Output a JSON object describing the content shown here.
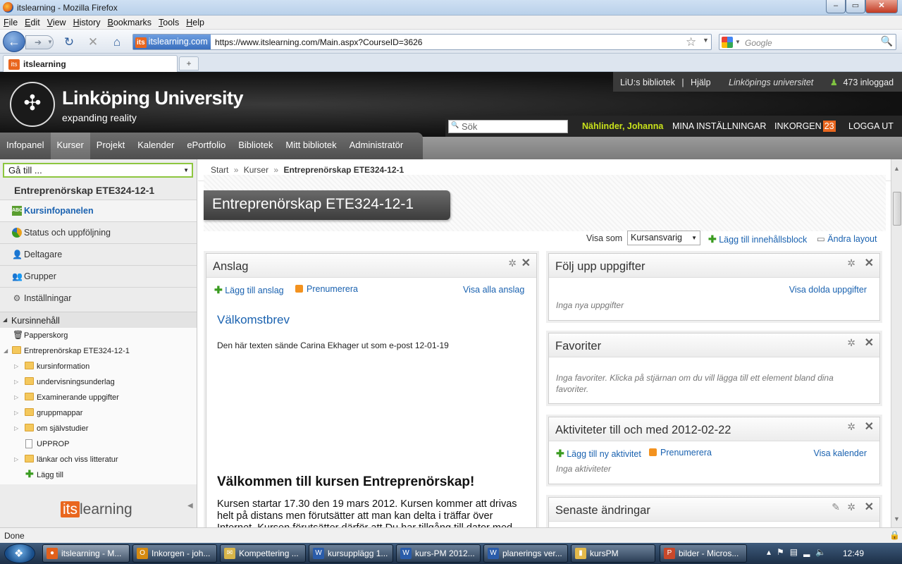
{
  "window": {
    "title": "itslearning - Mozilla Firefox",
    "controls": [
      "–",
      "▭",
      "✕"
    ]
  },
  "menu": [
    {
      "u": "F",
      "rest": "ile"
    },
    {
      "u": "E",
      "rest": "dit"
    },
    {
      "u": "V",
      "rest": "iew"
    },
    {
      "u": "H",
      "rest": "istory"
    },
    {
      "u": "B",
      "rest": "ookmarks"
    },
    {
      "u": "T",
      "rest": "ools"
    },
    {
      "u": "H",
      "rest": "elp"
    }
  ],
  "nav": {
    "identity_icon": "its",
    "identity": "itslearning.com",
    "url": "https://www.itslearning.com/Main.aspx?CourseID=3626",
    "search_placeholder": "Google"
  },
  "tab": {
    "icon": "its",
    "title": "itslearning",
    "new_tab": "+"
  },
  "header": {
    "university": "Linköping University",
    "tagline": "expanding reality",
    "logo_glyph": "✣",
    "top_links": {
      "library": "LiU:s bibliotek",
      "sep": "|",
      "help": "Hjälp",
      "uni": "Linköpings universitet",
      "online": "473 inloggad"
    },
    "search_placeholder": "Sök",
    "user": "Nählinder, Johanna",
    "settings": "MINA INSTÄLLNINGAR",
    "inbox": "INKORGEN",
    "inbox_count": "23",
    "logout": "LOGGA UT"
  },
  "mainnav": [
    "Infopanel",
    "Kurser",
    "Projekt",
    "Kalender",
    "ePortfolio",
    "Bibliotek",
    "Mitt bibliotek",
    "Administratör"
  ],
  "sidebar": {
    "goto": "Gå till ...",
    "course_title": "Entreprenörskap ETE324-12-1",
    "items": [
      "Kursinfopanelen",
      "Status och uppföljning",
      "Deltagare",
      "Grupper",
      "Inställningar"
    ],
    "content_header": "Kursinnehåll",
    "tree": {
      "trash": "Papperskorg",
      "root": "Entreprenörskap ETE324-12-1",
      "folders": [
        "kursinformation",
        "undervisningsunderlag",
        "Examinerande uppgifter",
        "gruppmappar",
        "om självstudier"
      ],
      "file": "UPPROP",
      "folder_last": "länkar och viss litteratur",
      "add": "Lägg till"
    },
    "logo_its": "its",
    "logo_learning": "learning"
  },
  "breadcrumb": {
    "start": "Start",
    "sep": "»",
    "kurser": "Kurser",
    "current": "Entreprenörskap ETE324-12-1"
  },
  "page_title": "Entreprenörskap ETE324-12-1",
  "toolbar": {
    "visa_som": "Visa som",
    "role": "Kursansvarig",
    "add_block": "Lägg till innehållsblock",
    "change_layout": "Ändra layout"
  },
  "anslag": {
    "title": "Anslag",
    "add": "Lägg till anslag",
    "subscribe": "Prenumerera",
    "view_all": "Visa alla anslag",
    "post_title": "Välkomstbrev",
    "post_meta": "Den här texten sände Carina Ekhager ut som e-post 12-01-19",
    "welcome_heading": "Välkommen till kursen Entreprenörskap!",
    "welcome_line1": "Kursen startar 17.30 den 19 mars 2012. Kursen kommer att drivas",
    "welcome_line2": "helt på distans men förutsätter att man kan delta i träffar över",
    "welcome_line3": "Internet. Kursen förutsätter därför att Du har tillgång till dator med"
  },
  "follow": {
    "title": "Följ upp uppgifter",
    "hidden": "Visa dolda uppgifter",
    "empty": "Inga nya uppgifter"
  },
  "favorites": {
    "title": "Favoriter",
    "empty_line1": "Inga favoriter. Klicka på stjärnan om du vill lägga till ett element bland dina",
    "empty_line2": "favoriter."
  },
  "activities": {
    "title": "Aktiviteter till och med 2012-02-22",
    "add": "Lägg till ny aktivitet",
    "subscribe": "Prenumerera",
    "calendar": "Visa kalender",
    "empty": "Inga aktiviteter"
  },
  "recent": {
    "title": "Senaste ändringar"
  },
  "status": "Done",
  "taskbar": [
    {
      "label": "itslearning - M...",
      "icon_color": "#e2601b",
      "icon": "●"
    },
    {
      "label": "Inkorgen - joh...",
      "icon_color": "#d68a10",
      "icon": "O"
    },
    {
      "label": "Kompettering ...",
      "icon_color": "#d8b54a",
      "icon": "✉"
    },
    {
      "label": "kursupplägg 1...",
      "icon_color": "#2a5caa",
      "icon": "W"
    },
    {
      "label": "kurs-PM 2012...",
      "icon_color": "#2a5caa",
      "icon": "W"
    },
    {
      "label": "planerings ver...",
      "icon_color": "#2a5caa",
      "icon": "W"
    },
    {
      "label": "kursPM",
      "icon_color": "#e3b94a",
      "icon": "▮"
    },
    {
      "label": "bilder - Micros...",
      "icon_color": "#c8482a",
      "icon": "P"
    }
  ],
  "clock": "12:49"
}
